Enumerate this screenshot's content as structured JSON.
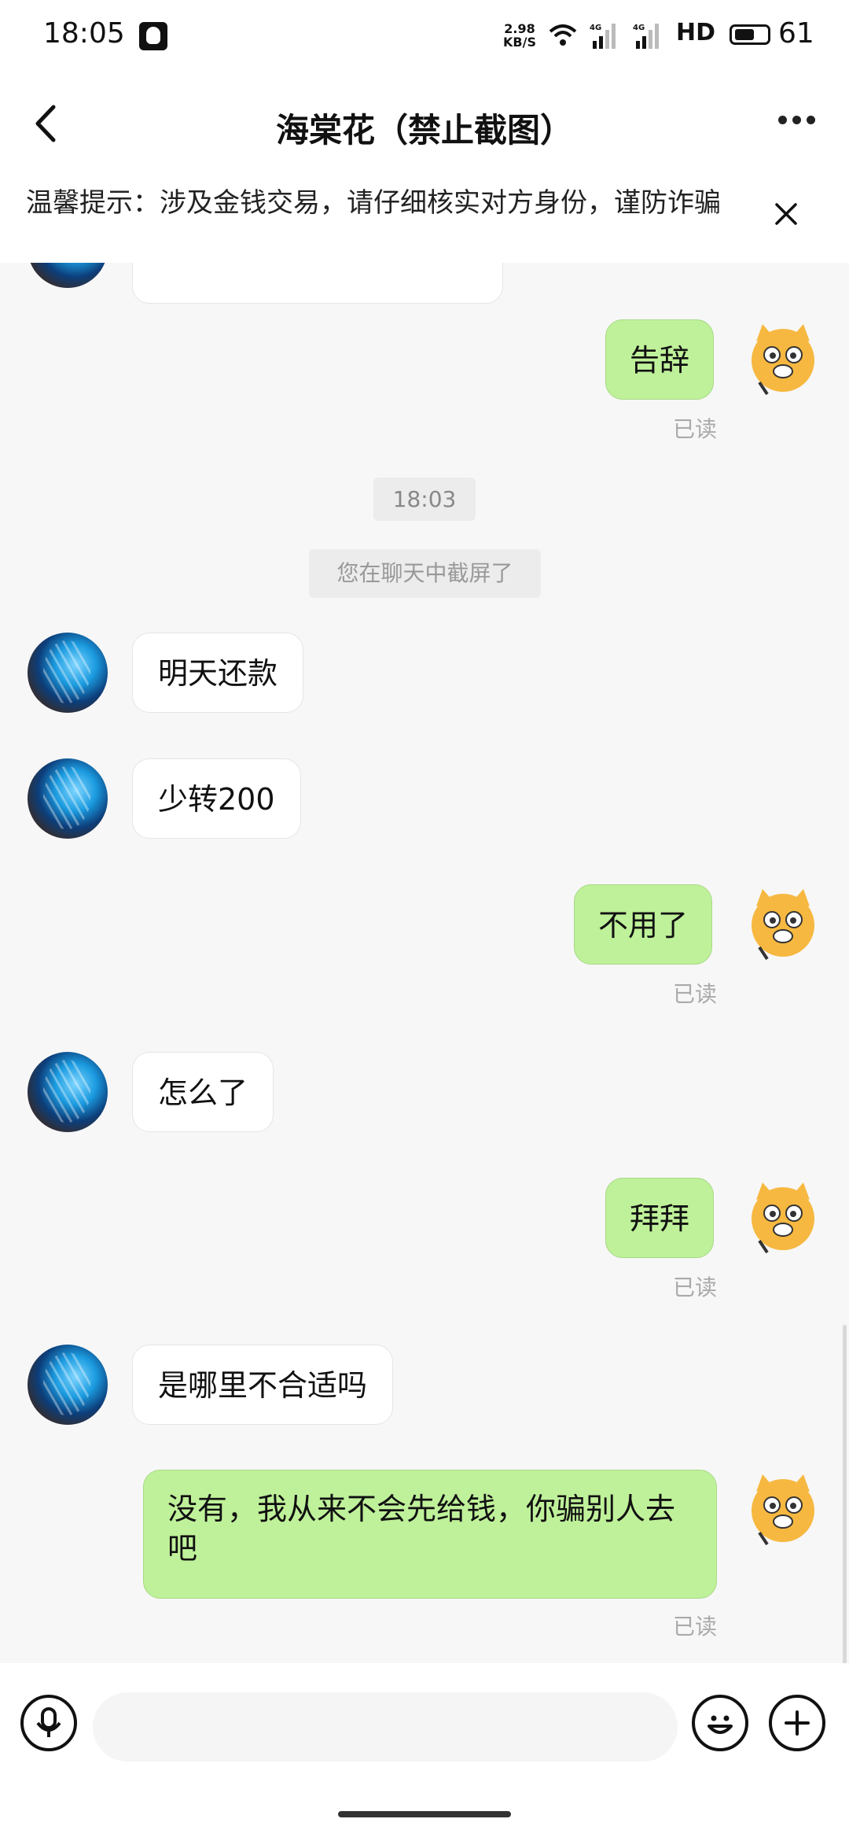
{
  "status_bar": {
    "time": "18:05",
    "speed_value": "2.98",
    "speed_unit": "KB/S",
    "network": "HD",
    "battery": "61",
    "battery_level": 0.61
  },
  "header": {
    "title": "海棠花（禁止截图）",
    "back_icon": "chevron-left-icon",
    "more_icon": "more-dots-icon"
  },
  "banner": {
    "text": "温馨提示：涉及金钱交易，请仔细核实对方身份，谨防诈骗"
  },
  "chat": {
    "messages": [
      {
        "side": "right",
        "text": "告辞",
        "status": "已读"
      },
      {
        "type": "time",
        "text": "18:03"
      },
      {
        "type": "system",
        "text": "您在聊天中截屏了"
      },
      {
        "side": "left",
        "text": "明天还款"
      },
      {
        "side": "left",
        "text": "少转200"
      },
      {
        "side": "right",
        "text": "不用了",
        "status": "已读"
      },
      {
        "side": "left",
        "text": "怎么了"
      },
      {
        "side": "right",
        "text": "拜拜",
        "status": "已读"
      },
      {
        "side": "left",
        "text": "是哪里不合适吗"
      },
      {
        "side": "right",
        "text": "没有，我从来不会先给钱，你骗别人去吧",
        "status": "已读"
      }
    ]
  },
  "input_bar": {
    "placeholder": "",
    "voice_icon": "microphone-icon",
    "emoji_icon": "smiley-icon",
    "plus_icon": "plus-icon"
  },
  "colors": {
    "outgoing_bubble": "#bff19a",
    "incoming_bubble": "#ffffff",
    "chat_background": "#f7f7f7"
  }
}
